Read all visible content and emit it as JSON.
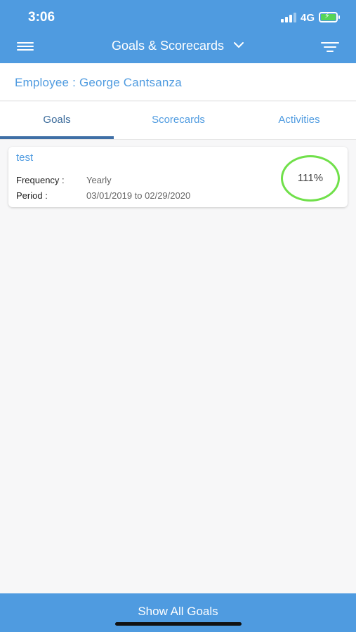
{
  "status_bar": {
    "time": "3:06",
    "network": "4G"
  },
  "header": {
    "title": "Goals & Scorecards",
    "icons": [
      "hamburger-menu-icon",
      "chevron-down-icon",
      "filter-icon"
    ]
  },
  "employee": {
    "label": "Employee : George Cantsanza"
  },
  "tabs": [
    {
      "label": "Goals",
      "active": true
    },
    {
      "label": "Scorecards",
      "active": false
    },
    {
      "label": "Activities",
      "active": false
    }
  ],
  "goals": [
    {
      "title": "test",
      "frequency_label": "Frequency :",
      "frequency_value": "Yearly",
      "period_label": "Period :",
      "period_value": "03/01/2019 to 02/29/2020",
      "percent": "111%"
    }
  ],
  "footer": {
    "button_label": "Show All Goals"
  },
  "colors": {
    "primary": "#4f9be0",
    "tab_indicator": "#3f6fa6",
    "progress_ring": "#70e04a",
    "background": "#f7f7f8"
  }
}
